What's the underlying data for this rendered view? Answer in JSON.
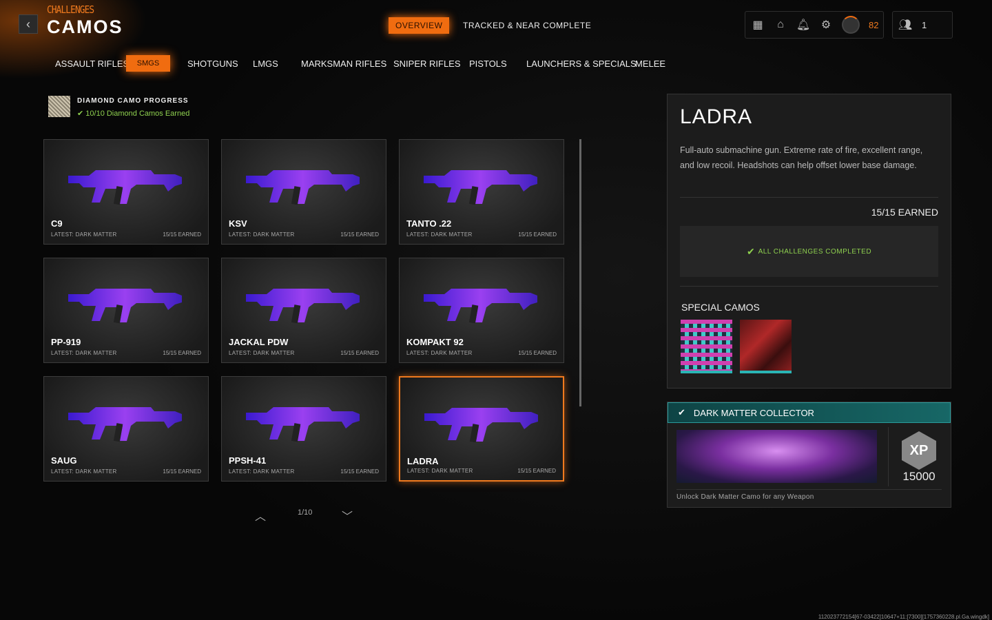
{
  "header": {
    "breadcrumb": "CHALLENGES",
    "title": "CAMOS",
    "back": "‹",
    "tabs": [
      "OVERVIEW",
      "TRACKED & NEAR COMPLETE"
    ],
    "level": "82",
    "party_count": "1"
  },
  "categories": [
    "ASSAULT RIFLES",
    "SMGS",
    "SHOTGUNS",
    "LMGS",
    "MARKSMAN RIFLES",
    "SNIPER RIFLES",
    "PISTOLS",
    "LAUNCHERS & SPECIALS",
    "MELEE"
  ],
  "diamond": {
    "title": "DIAMOND CAMO PROGRESS",
    "status": "10/10 Diamond Camos Earned"
  },
  "weapons": [
    {
      "name": "C9",
      "latest": "LATEST: DARK MATTER",
      "earned": "15/15 EARNED"
    },
    {
      "name": "KSV",
      "latest": "LATEST: DARK MATTER",
      "earned": "15/15 EARNED"
    },
    {
      "name": "TANTO .22",
      "latest": "LATEST: DARK MATTER",
      "earned": "15/15 EARNED"
    },
    {
      "name": "PP-919",
      "latest": "LATEST: DARK MATTER",
      "earned": "15/15 EARNED"
    },
    {
      "name": "JACKAL PDW",
      "latest": "LATEST: DARK MATTER",
      "earned": "15/15 EARNED"
    },
    {
      "name": "KOMPAKT 92",
      "latest": "LATEST: DARK MATTER",
      "earned": "15/15 EARNED"
    },
    {
      "name": "SAUG",
      "latest": "LATEST: DARK MATTER",
      "earned": "15/15 EARNED"
    },
    {
      "name": "PPSH-41",
      "latest": "LATEST: DARK MATTER",
      "earned": "15/15 EARNED"
    },
    {
      "name": "LADRA",
      "latest": "LATEST: DARK MATTER",
      "earned": "15/15 EARNED"
    }
  ],
  "pager": {
    "page": "1/10"
  },
  "detail": {
    "name": "LADRA",
    "description": "Full-auto submachine gun.  Extreme rate of fire, excellent range, and low recoil. Headshots can help offset lower base damage.",
    "earned": "15/15 EARNED",
    "status": "ALL CHALLENGES COMPLETED",
    "special_title": "SPECIAL CAMOS"
  },
  "reward": {
    "title": "DARK MATTER COLLECTOR",
    "xp_label": "XP",
    "xp": "15000",
    "description": "Unlock Dark Matter Camo for any Weapon"
  },
  "build": "112023772154[67-03422]10647+11:[7300][1757360228.pl.Ga.wingdk]",
  "colors": {
    "accent": "#f06c10",
    "success": "#8fd14f",
    "teal": "#176766"
  }
}
